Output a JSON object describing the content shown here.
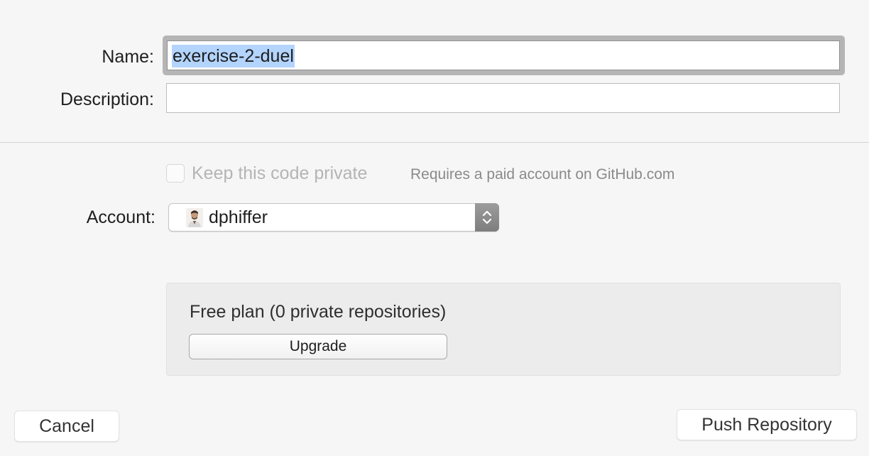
{
  "form": {
    "name_label": "Name:",
    "name_value": "exercise-2-duel",
    "description_label": "Description:",
    "description_value": ""
  },
  "privacy": {
    "checkbox_label": "Keep this code private",
    "checked": false,
    "note": "Requires a paid account on GitHub.com"
  },
  "account": {
    "label": "Account:",
    "selected": "dphiffer",
    "avatar_icon": "user-avatar"
  },
  "plan": {
    "text": "Free plan (0 private repositories)",
    "upgrade_label": "Upgrade"
  },
  "buttons": {
    "cancel_label": "Cancel",
    "push_label": "Push Repository"
  },
  "colors": {
    "selection_highlight": "#b3d4fd",
    "stepper": "#8a8a8a",
    "background": "#f6f6f6"
  }
}
